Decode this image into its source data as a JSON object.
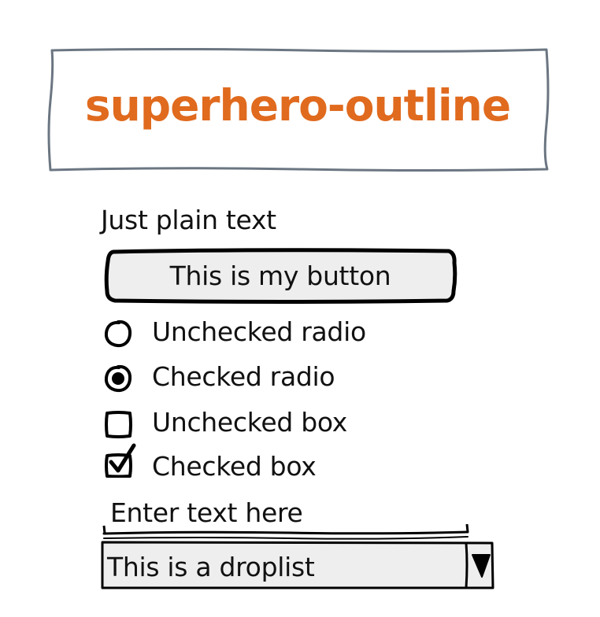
{
  "theme": {
    "name": "superhero-outline",
    "accent_color": "#e06a1e",
    "frame_color": "#6b7682",
    "control_fill": "#eeeeee"
  },
  "plain_text": "Just plain text",
  "button": {
    "label": "This is my button"
  },
  "radios": [
    {
      "label": "Unchecked radio",
      "checked": false
    },
    {
      "label": "Checked radio",
      "checked": true
    }
  ],
  "checkboxes": [
    {
      "label": "Unchecked box",
      "checked": false
    },
    {
      "label": "Checked box",
      "checked": true
    }
  ],
  "text_input": {
    "value": "Enter text here"
  },
  "droplist": {
    "selected": "This is a droplist",
    "arrow_icon": "triangle-down-icon"
  }
}
